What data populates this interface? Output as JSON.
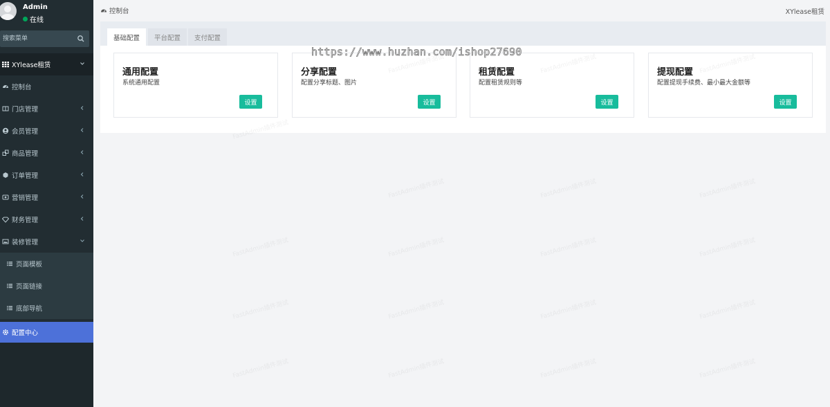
{
  "user": {
    "name": "Admin",
    "status": "在线"
  },
  "search": {
    "placeholder": "搜索菜单"
  },
  "menu": {
    "group": "XYlease租赁",
    "items": [
      {
        "label": "控制台",
        "icon": "dashboard-icon"
      },
      {
        "label": "门店管理",
        "icon": "store-icon"
      },
      {
        "label": "会员管理",
        "icon": "user-icon"
      },
      {
        "label": "商品管理",
        "icon": "goods-icon"
      },
      {
        "label": "订单管理",
        "icon": "order-icon"
      },
      {
        "label": "营销管理",
        "icon": "marketing-icon"
      },
      {
        "label": "财务管理",
        "icon": "diamond-icon"
      },
      {
        "label": "装修管理",
        "icon": "image-icon"
      }
    ],
    "submenu": [
      "页面模板",
      "页面链接",
      "底部导航"
    ],
    "active": "配置中心"
  },
  "topbar": {
    "breadcrumb": "控制台",
    "brand": "XYlease租赁"
  },
  "tabs": [
    "基础配置",
    "平台配置",
    "支付配置"
  ],
  "watermark_url": "https://www.huzhan.com/ishop27690",
  "watermark_text": "FastAdmin插件测试",
  "cards": [
    {
      "title": "通用配置",
      "desc": "系统通用配置",
      "button": "设置"
    },
    {
      "title": "分享配置",
      "desc": "配置分享标题、图片",
      "button": "设置"
    },
    {
      "title": "租赁配置",
      "desc": "配置租赁规则等",
      "button": "设置"
    },
    {
      "title": "提现配置",
      "desc": "配置提现手续费、最小最大金额等",
      "button": "设置"
    }
  ],
  "colors": {
    "sidebar": "#222d32",
    "active": "#4d71d9",
    "button": "#18bc9c",
    "online": "#00a65a"
  }
}
